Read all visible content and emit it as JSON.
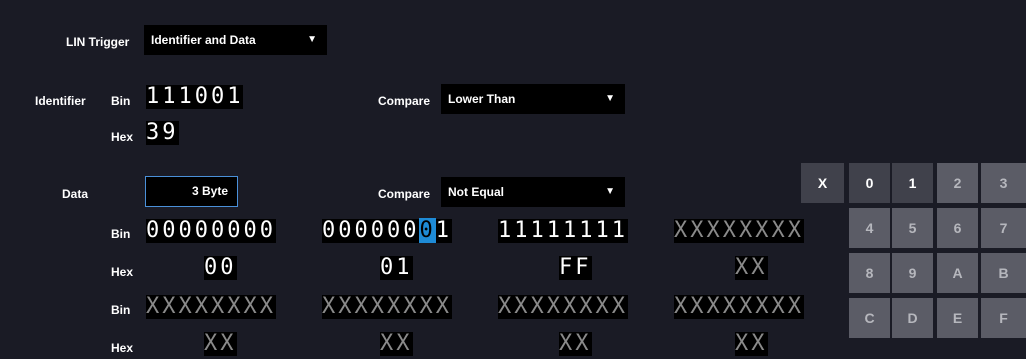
{
  "trigger": {
    "label": "LIN Trigger",
    "type_value": "Identifier and Data"
  },
  "identifier": {
    "label": "Identifier",
    "bin_label": "Bin",
    "bin_value": "111001",
    "hex_label": "Hex",
    "hex_value": "39",
    "compare_label": "Compare",
    "compare_value": "Lower Than"
  },
  "data": {
    "label": "Data",
    "length_value": "3 Byte",
    "compare_label": "Compare",
    "compare_value": "Not Equal",
    "row1": {
      "bin_label": "Bin",
      "hex_label": "Hex",
      "bytes": [
        {
          "bin": "00000000",
          "hex": "00"
        },
        {
          "bin_before": "000000",
          "bin_cursor": "0",
          "bin_after": "1",
          "hex": "01"
        },
        {
          "bin": "11111111",
          "hex": "FF"
        },
        {
          "bin": "XXXXXXXX",
          "hex": "XX"
        }
      ]
    },
    "row2": {
      "bin_label": "Bin",
      "hex_label": "Hex",
      "bytes": [
        {
          "bin": "XXXXXXXX",
          "hex": "XX"
        },
        {
          "bin": "XXXXXXXX",
          "hex": "XX"
        },
        {
          "bin": "XXXXXXXX",
          "hex": "XX"
        },
        {
          "bin": "XXXXXXXX",
          "hex": "XX"
        }
      ]
    }
  },
  "keypad": {
    "keys": [
      "X",
      "0",
      "1",
      "2",
      "3",
      "4",
      "5",
      "6",
      "7",
      "8",
      "9",
      "A",
      "B",
      "C",
      "D",
      "E",
      "F"
    ],
    "active_keys": [
      "X",
      "0",
      "1"
    ]
  },
  "icons": {
    "dropdown": "chevron-down-icon"
  },
  "colors": {
    "background": "#1a1b25",
    "cursor": "#1e8bd6",
    "key_active": "#40414b",
    "key_disabled": "#5b5c66"
  }
}
